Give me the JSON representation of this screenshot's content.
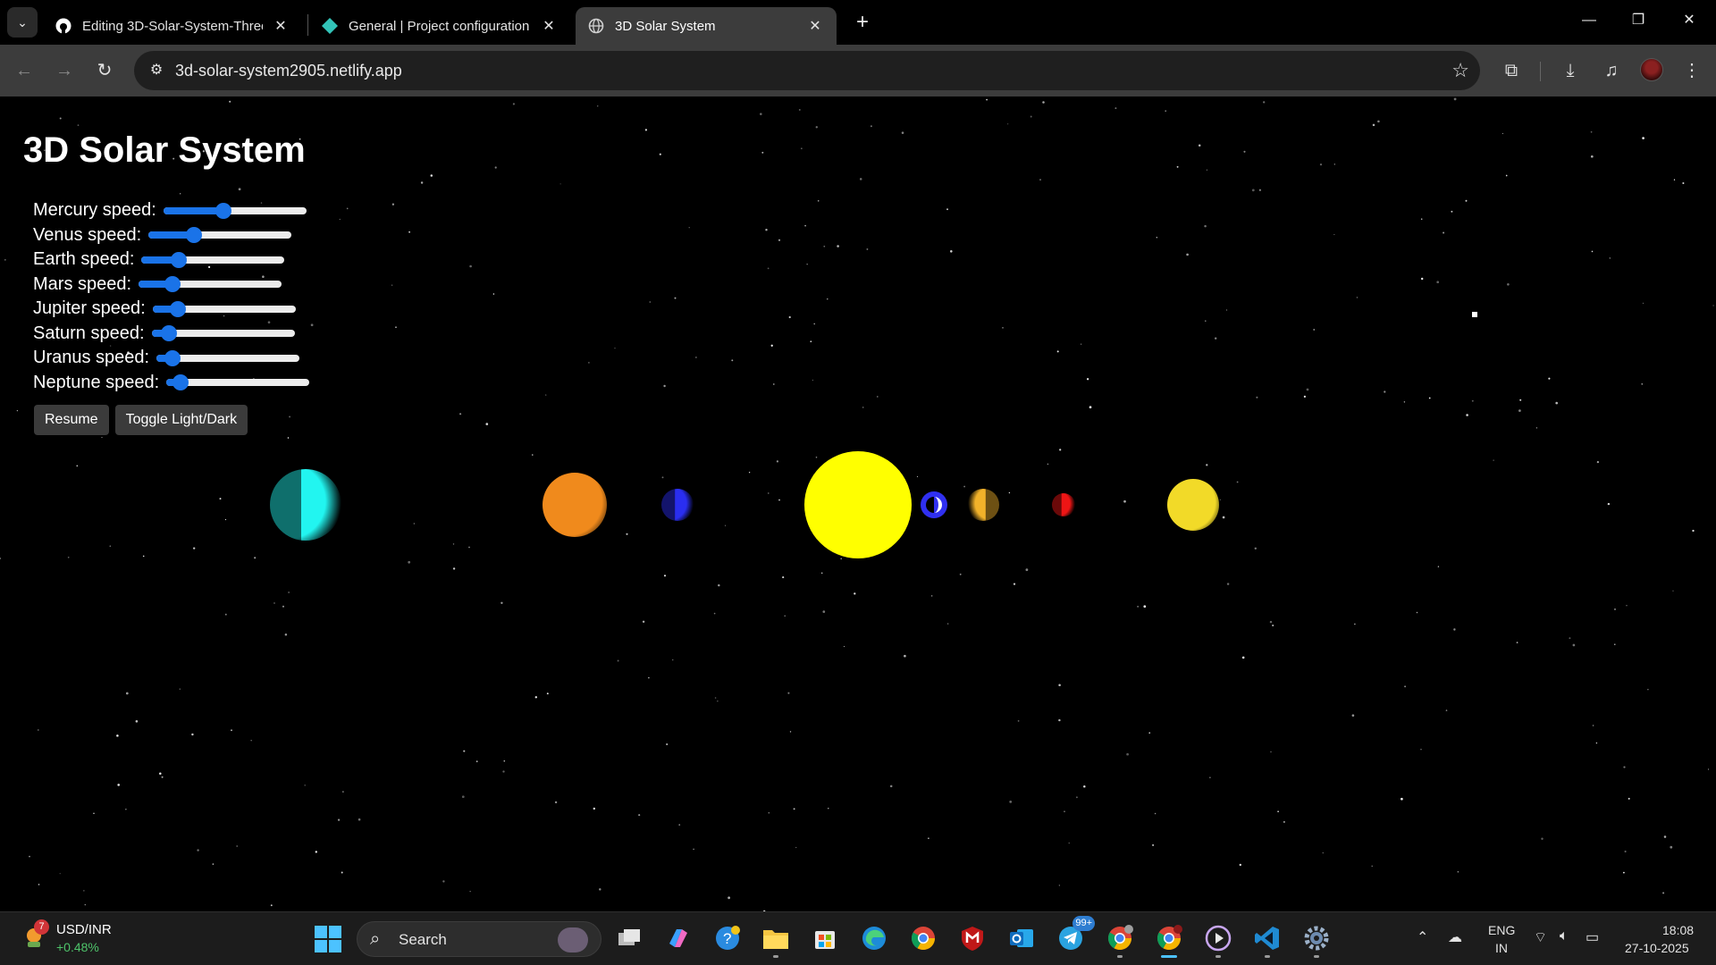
{
  "browser": {
    "tabs": [
      {
        "title": "Editing 3D-Solar-System-Three",
        "favicon": "github-icon",
        "active": false
      },
      {
        "title": "General | Project configuration |",
        "favicon": "netlify-icon",
        "active": false
      },
      {
        "title": "3D Solar System",
        "favicon": "globe-icon",
        "active": true
      }
    ],
    "url": "3d-solar-system2905.netlify.app"
  },
  "page": {
    "title": "3D Solar System",
    "controls": [
      {
        "label": "Mercury speed:",
        "value": 0.42
      },
      {
        "label": "Venus speed:",
        "value": 0.32
      },
      {
        "label": "Earth speed:",
        "value": 0.26
      },
      {
        "label": "Mars speed:",
        "value": 0.24
      },
      {
        "label": "Jupiter speed:",
        "value": 0.18
      },
      {
        "label": "Saturn speed:",
        "value": 0.12
      },
      {
        "label": "Uranus speed:",
        "value": 0.11
      },
      {
        "label": "Neptune speed:",
        "value": 0.1
      }
    ],
    "buttons": {
      "resume": "Resume",
      "toggle_theme": "Toggle Light/Dark"
    },
    "bodies": [
      {
        "name": "neptune",
        "color": "#22f5f0",
        "shading": "right"
      },
      {
        "name": "jupiter",
        "color": "#f08a1c",
        "shading": "round"
      },
      {
        "name": "uranus",
        "color": "#2a2ef0",
        "shading": "right"
      },
      {
        "name": "sun",
        "color": "#ffff00",
        "shading": "flat"
      },
      {
        "name": "mercury",
        "color": "#3030f0",
        "shading": "ring"
      },
      {
        "name": "venus",
        "color": "#f2b22a",
        "shading": "left"
      },
      {
        "name": "mars",
        "color": "#ee1515",
        "shading": "right"
      },
      {
        "name": "saturn",
        "color": "#f2da28",
        "shading": "round"
      }
    ],
    "accent_color": "#1a73e8",
    "background_color": "#000000"
  },
  "taskbar": {
    "widget": {
      "title": "USD/INR",
      "change": "+0.48%",
      "badge": "7"
    },
    "search_placeholder": "Search",
    "telegram_badge": "99+",
    "language": {
      "line1": "ENG",
      "line2": "IN"
    },
    "clock": {
      "time": "18:08",
      "date": "27-10-2025"
    }
  }
}
